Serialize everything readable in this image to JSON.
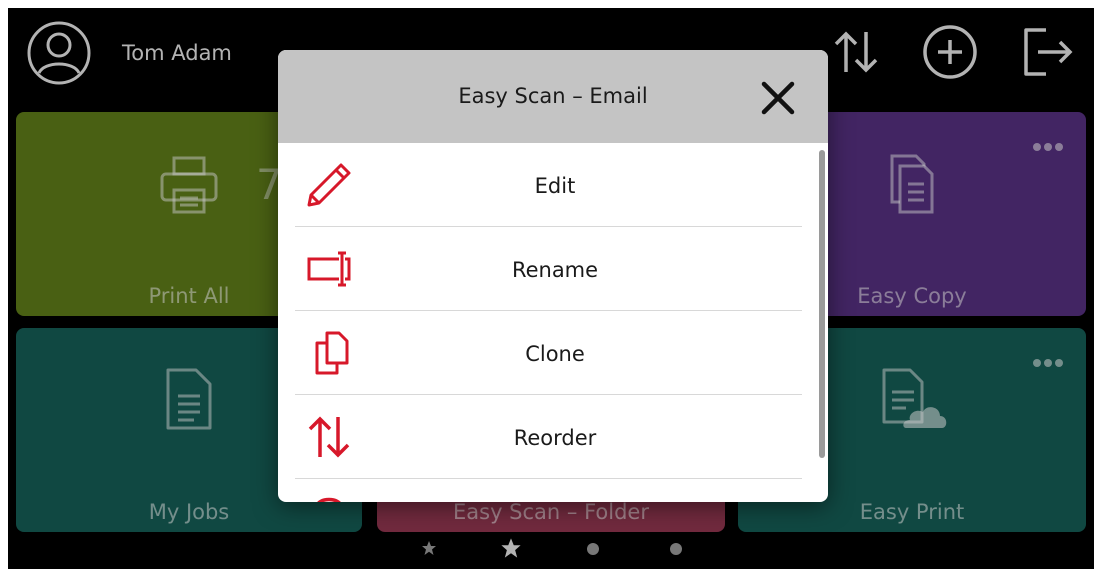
{
  "header": {
    "user_name": "Tom Adam",
    "icons": [
      "user-avatar-icon",
      "reorder-arrows-icon",
      "add-circle-icon",
      "logout-icon"
    ]
  },
  "tiles": [
    {
      "label": "Print All",
      "count": "7",
      "color": "#5e7b19",
      "icon": "printer-icon"
    },
    {
      "label": "Easy Copy",
      "color": "#55307f",
      "icon": "copy-document-icon"
    },
    {
      "label": "My Jobs",
      "color": "#155d55",
      "icon": "document-icon"
    },
    {
      "label": "Easy Scan – Folder",
      "color": "#913650",
      "icon": "folder-icon"
    },
    {
      "label": "Easy Print",
      "color": "#155d55",
      "icon": "cloud-document-icon"
    }
  ],
  "pager": {
    "count": 4,
    "active": 1
  },
  "modal": {
    "title": "Easy Scan – Email",
    "accent": "#d7182a",
    "items": [
      {
        "label": "Edit",
        "icon": "pencil-icon"
      },
      {
        "label": "Rename",
        "icon": "rename-icon"
      },
      {
        "label": "Clone",
        "icon": "clone-icon"
      },
      {
        "label": "Reorder",
        "icon": "reorder-icon"
      },
      {
        "label": "",
        "icon": "partial-icon"
      }
    ]
  }
}
